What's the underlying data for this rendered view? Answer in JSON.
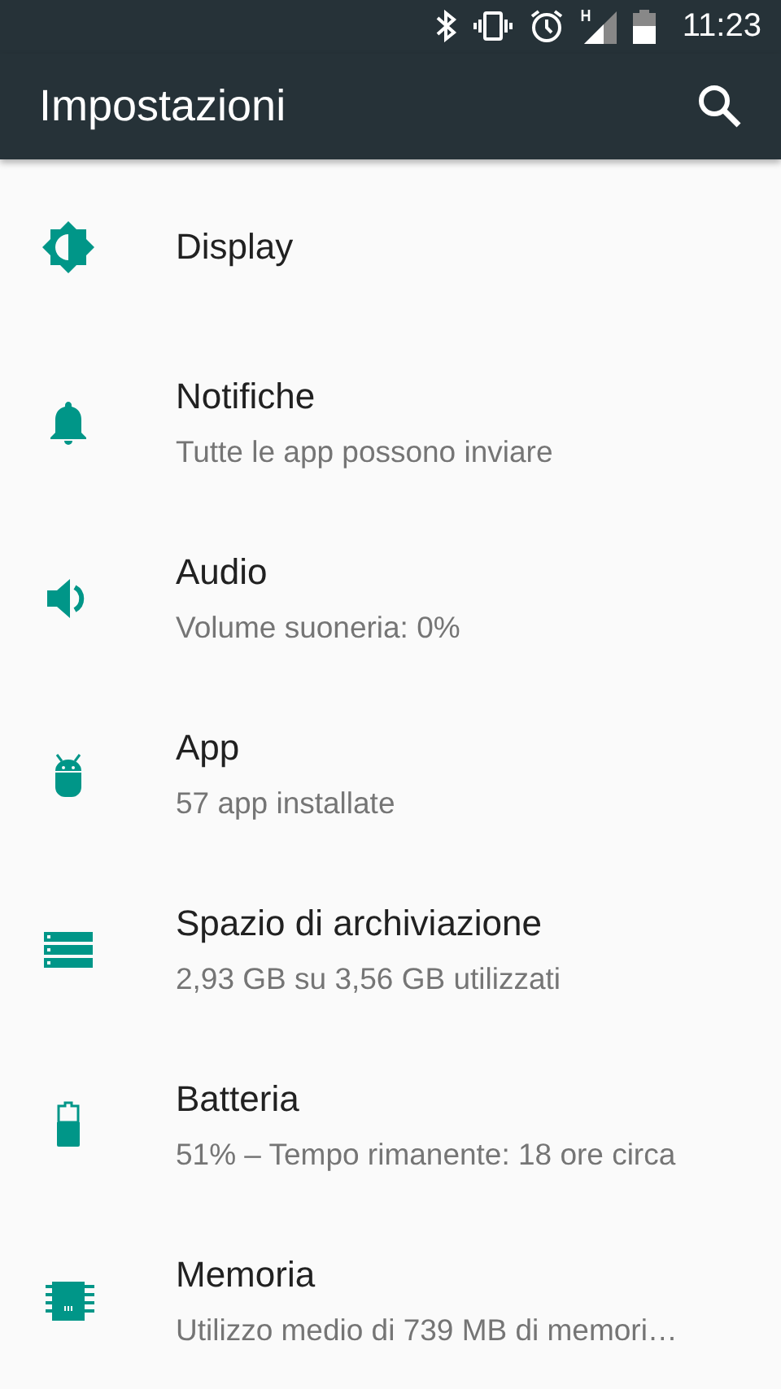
{
  "status_bar": {
    "time": "11:23"
  },
  "app_bar": {
    "title": "Impostazioni"
  },
  "settings": [
    {
      "title": "Display"
    },
    {
      "title": "Notifiche",
      "subtitle": "Tutte le app possono inviare"
    },
    {
      "title": "Audio",
      "subtitle": "Volume suoneria: 0%"
    },
    {
      "title": "App",
      "subtitle": "57 app installate"
    },
    {
      "title": "Spazio di archiviazione",
      "subtitle": "2,93 GB su 3,56 GB utilizzati"
    },
    {
      "title": "Batteria",
      "subtitle": "51% – Tempo rimanente: 18 ore circa"
    },
    {
      "title": "Memoria",
      "subtitle": "Utilizzo medio di 739 MB di memori…"
    }
  ]
}
